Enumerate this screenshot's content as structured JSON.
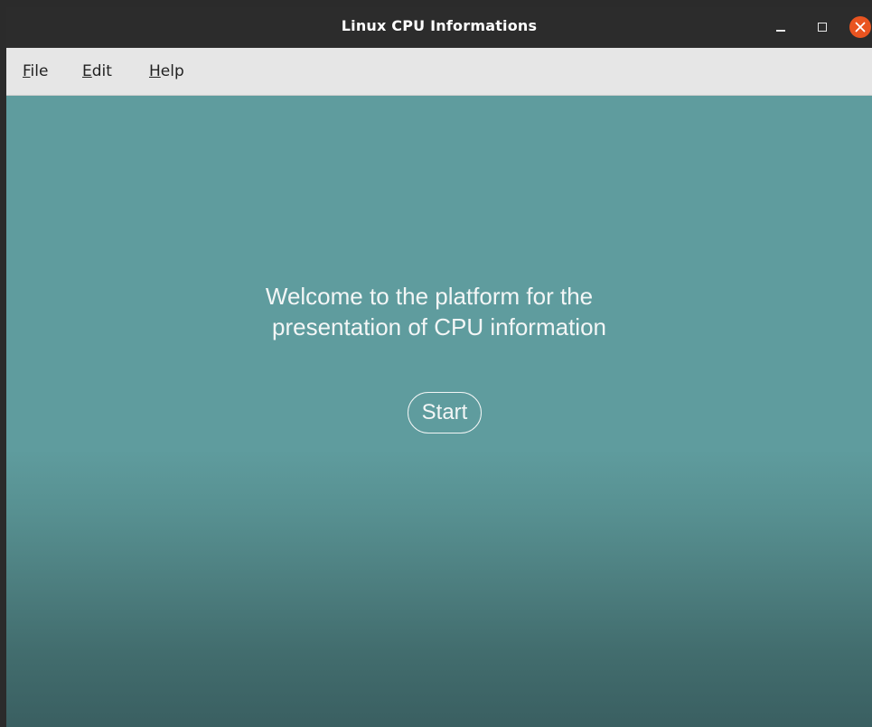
{
  "window": {
    "title": "Linux CPU Informations"
  },
  "menubar": {
    "items": [
      {
        "mnemonic": "F",
        "rest": "ile"
      },
      {
        "mnemonic": "E",
        "rest": "dit"
      },
      {
        "mnemonic": "H",
        "rest": "elp"
      }
    ]
  },
  "main": {
    "welcome_line1": "Welcome to the platform for the",
    "welcome_line2": "presentation of CPU information",
    "start_label": "Start"
  },
  "colors": {
    "titlebar": "#2c2c2c",
    "menubar": "#e6e6e6",
    "content_top": "#5f9c9e",
    "content_bottom": "#3a5f61",
    "close_button": "#e95420"
  },
  "icons": {
    "minimize": "minimize-icon",
    "maximize": "maximize-icon",
    "close": "close-icon"
  }
}
